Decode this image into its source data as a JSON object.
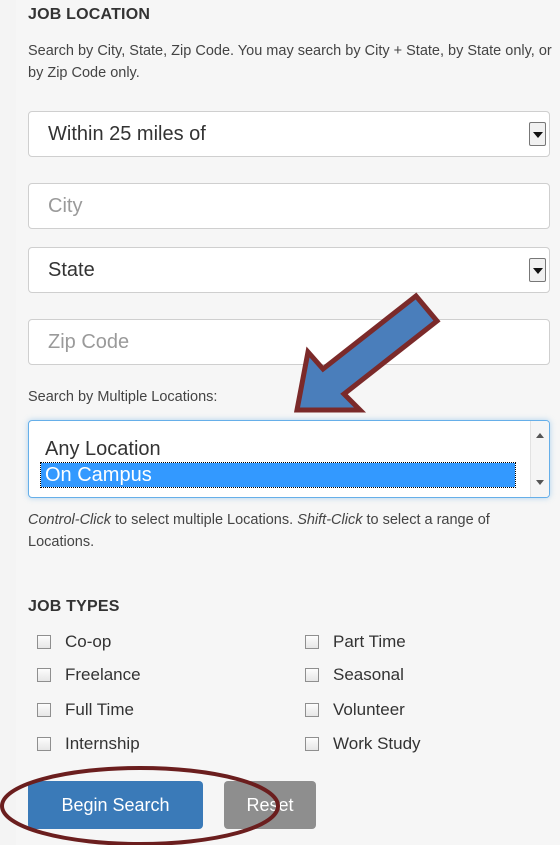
{
  "location": {
    "heading": "JOB LOCATION",
    "help": "Search by City, State, Zip Code. You may search by City + State, by State only, or by Zip Code only.",
    "radius_value": "Within 25 miles of",
    "city_placeholder": "City",
    "state_value": "State",
    "zip_placeholder": "Zip Code",
    "multi_label": "Search by Multiple Locations:",
    "options": [
      "Any Location",
      "On Campus"
    ],
    "selected_option": "On Campus",
    "hint_ctrl": "Control-Click",
    "hint_ctrl_rest": " to select multiple Locations. ",
    "hint_shift": "Shift-Click",
    "hint_shift_rest": " to select a range of Locations."
  },
  "job_types": {
    "heading": "JOB TYPES",
    "left": [
      "Co-op",
      "Freelance",
      "Full Time",
      "Internship"
    ],
    "right": [
      "Part Time",
      "Seasonal",
      "Volunteer",
      "Work Study"
    ]
  },
  "actions": {
    "search_label": "Begin Search",
    "reset_label": "Reset"
  },
  "annotations": {
    "arrow_color": "#7b2a2a",
    "arrow_fill": "#4a7ebb",
    "circle_color": "#6b1e1e"
  }
}
